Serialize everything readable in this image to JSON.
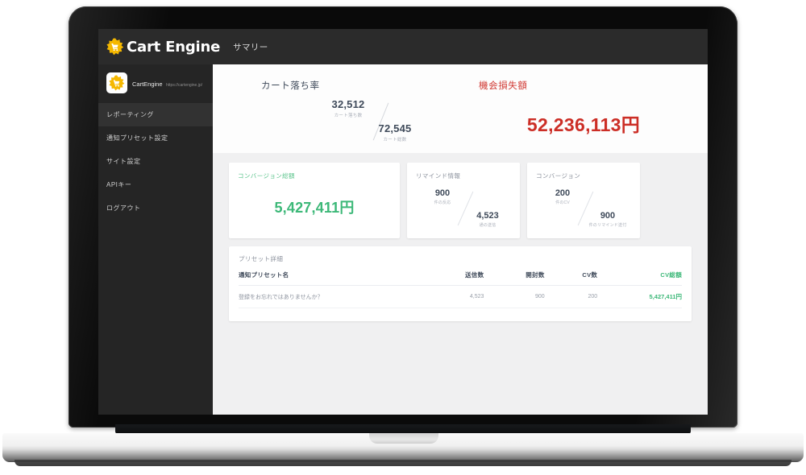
{
  "topbar": {
    "logo_icon": "sunburst-cart-icon",
    "brand": "Cart Engine",
    "page_label": "サマリー"
  },
  "sidebar": {
    "site": {
      "icon": "sunburst-cart-icon",
      "name": "CartEngine",
      "url": "https://cartengine.jp/"
    },
    "items": [
      {
        "label": "レポーティング",
        "active": true
      },
      {
        "label": "通知プリセット設定",
        "active": false
      },
      {
        "label": "サイト設定",
        "active": false
      },
      {
        "label": "APIキー",
        "active": false
      },
      {
        "label": "ログアウト",
        "active": false
      }
    ]
  },
  "hero": {
    "cart_abandon": {
      "title": "カート落ち率",
      "numerator_value": "32,512",
      "numerator_label": "カート落ち数",
      "denominator_value": "72,545",
      "denominator_label": "カート総数"
    },
    "opportunity_loss": {
      "title": "機会損失額",
      "amount": "52,236,113円"
    }
  },
  "cards": {
    "conversion_total": {
      "label": "コンバージョン総額",
      "amount": "5,427,411円"
    },
    "remind_info": {
      "label": "リマインド情報",
      "numerator_value": "900",
      "numerator_label": "件の反応",
      "denominator_value": "4,523",
      "denominator_label": "通の送信"
    },
    "conversion": {
      "label": "コンバージョン",
      "numerator_value": "200",
      "numerator_label": "件のCV",
      "denominator_value": "900",
      "denominator_label": "件のリマインド送付"
    }
  },
  "preset_table": {
    "title": "プリセット詳細",
    "columns": [
      "通知プリセット名",
      "送信数",
      "開封数",
      "CV数",
      "CV総額"
    ],
    "rows": [
      {
        "name": "登録をお忘れではありませんか？",
        "sent": "4,523",
        "opened": "900",
        "cv": "200",
        "cv_total": "5,427,411円"
      }
    ]
  },
  "colors": {
    "topbar_bg": "#2b2b2b",
    "sidebar_bg": "#252525",
    "danger_red": "#cc2e26",
    "success_green": "#3cb878",
    "logo_yellow": "#f5b800"
  }
}
